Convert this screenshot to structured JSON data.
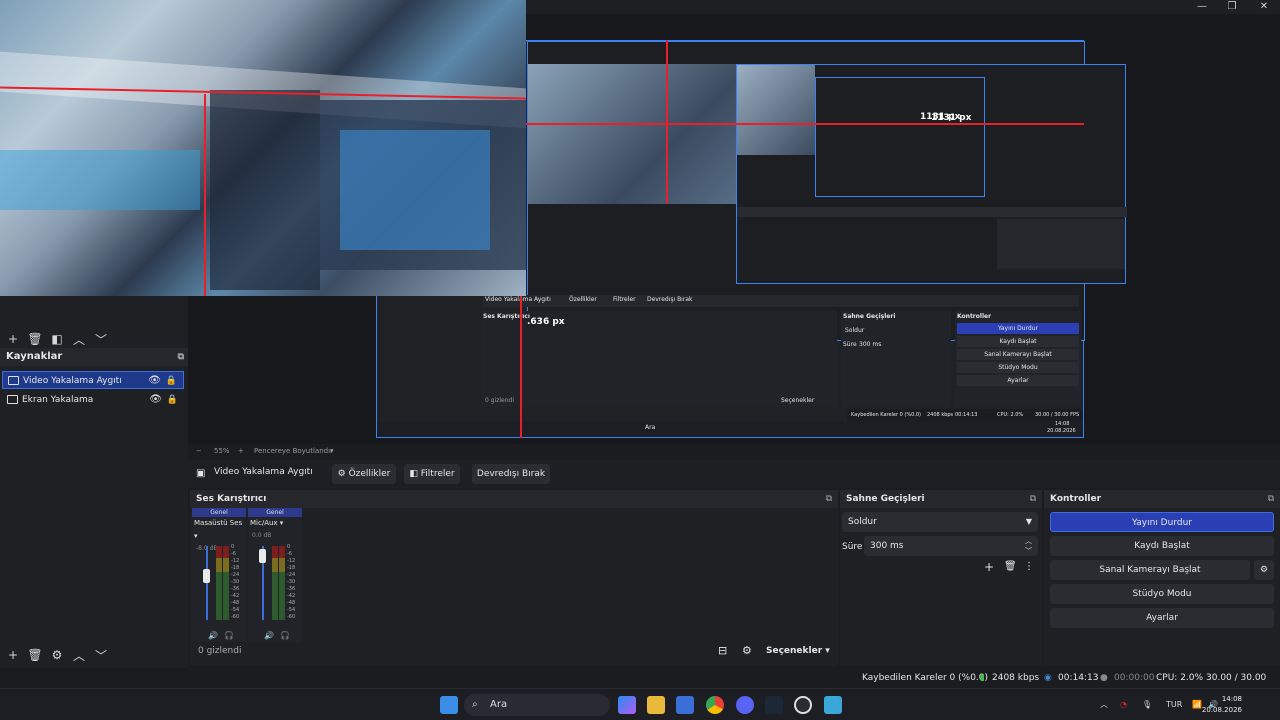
{
  "window": {
    "minimize": "—",
    "maximize": "❐",
    "close": "✕"
  },
  "preview": {
    "nested_label_1": "1131 px",
    "nested_label_2": "1131 px",
    "nested_label_3": ".636 px"
  },
  "nested_ui": {
    "source_name": "Video Yakalama Aygıtı",
    "props": "Özellikler",
    "filters": "Filtreler",
    "deactivate": "Devredışı Bırak",
    "mixer": "Ses Karıştırıcı",
    "transitions": "Sahne Geçişleri",
    "controls": "Kontroller",
    "fade": "Soldur",
    "duration_label": "Süre",
    "duration": "300 ms",
    "stop_stream": "Yayını Durdur",
    "start_rec": "Kaydı Başlat",
    "start_vcam": "Sanal Kamerayı Başlat",
    "studio": "Stüdyo Modu",
    "settings": "Ayarlar",
    "hidden": "0 gizlendi",
    "options": "Seçenekler",
    "status_frames": "Kaybedilen Kareler 0 (%0.0)",
    "status_kbps": "2408 kbps",
    "status_time": "00:14:13",
    "status_cpu": "CPU: 2.0%",
    "status_fps": "30.00 / 30.00 FPS",
    "search": "Ara",
    "clock_time": "14:08",
    "clock_date": "20.08.2026"
  },
  "left_dock": {
    "sources_title": "Kaynaklar",
    "sources": [
      {
        "name": "Video Yakalama Aygıtı",
        "selected": true
      },
      {
        "name": "Ekran Yakalama",
        "selected": false
      }
    ]
  },
  "zoom_bar": {
    "minus": "−",
    "zoom": "55%",
    "plus": "+",
    "fit": "Pencereye Boyutlandır"
  },
  "source_bar": {
    "name": "Video Yakalama Aygıtı",
    "properties": "Özellikler",
    "filters": "Filtreler",
    "deactivate": "Devredışı Bırak"
  },
  "mixer": {
    "title": "Ses Karıştırıcı",
    "channels": [
      {
        "tag": "Genel",
        "name": "Masaüstü Ses",
        "db": "-8.0 dB",
        "level": 0.62
      },
      {
        "tag": "Genel",
        "name": "Mic/Aux",
        "db": "0.0 dB",
        "level": 0.95
      }
    ],
    "scale": [
      "0",
      "-6",
      "-12",
      "-18",
      "-24",
      "-30",
      "-36",
      "-42",
      "-48",
      "-54",
      "-60"
    ],
    "hidden": "0 gizlendi",
    "options": "Seçenekler"
  },
  "transitions": {
    "title": "Sahne Geçişleri",
    "selected": "Soldur",
    "duration_label": "Süre",
    "duration": "300 ms"
  },
  "controls": {
    "title": "Kontroller",
    "stop_stream": "Yayını Durdur",
    "start_recording": "Kaydı Başlat",
    "start_virtual_cam": "Sanal Kamerayı Başlat",
    "studio_mode": "Stüdyo Modu",
    "settings": "Ayarlar"
  },
  "status": {
    "dropped": "Kaybedilen Kareler 0 (%0.0)",
    "bitrate": "2408 kbps",
    "stream_time": "00:14:13",
    "rec_time": "00:00:00",
    "cpu": "CPU: 2.0%",
    "fps": "30.00 / 30.00 FPS"
  },
  "taskbar": {
    "search": "Ara",
    "lang": "TUR",
    "time": "14:08",
    "date": "20.08.2026"
  },
  "colors": {
    "accent": "#3c6ee0",
    "selection": "#1f3a8a",
    "red_guide": "#e8202a",
    "primary_button": "#2a3fb4"
  }
}
